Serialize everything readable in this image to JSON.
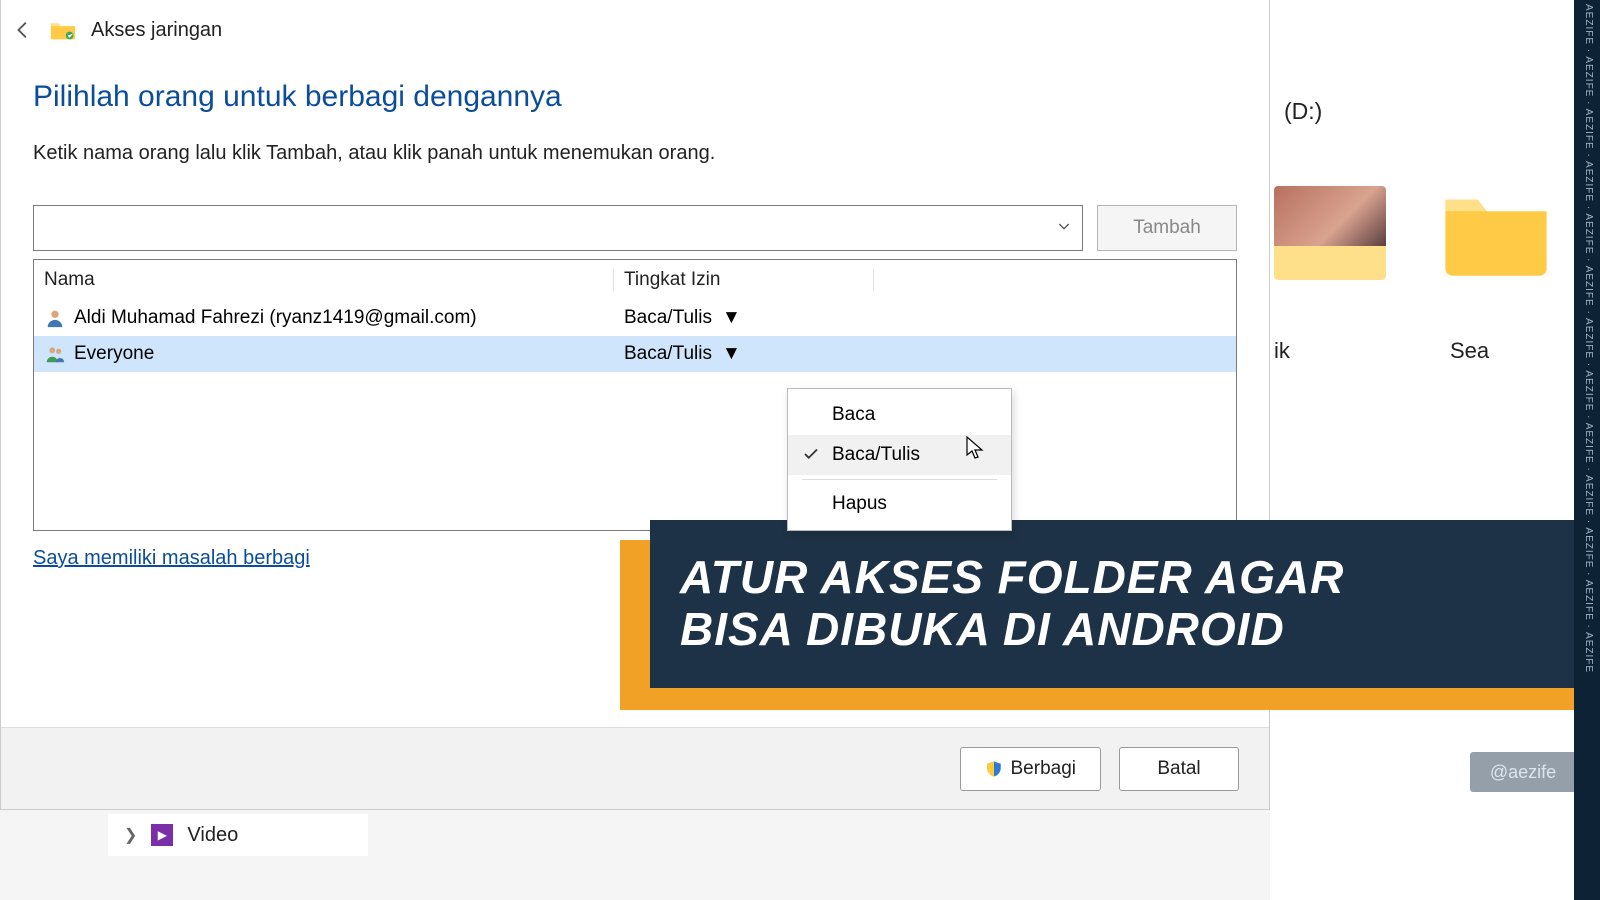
{
  "titlebar": {
    "title": "Akses jaringan"
  },
  "heading": "Pilihlah orang untuk berbagi dengannya",
  "instruction": "Ketik nama orang lalu klik Tambah, atau klik panah untuk menemukan orang.",
  "add_button": "Tambah",
  "table": {
    "col_name": "Nama",
    "col_perm": "Tingkat Izin",
    "rows": [
      {
        "name": "Aldi Muhamad Fahrezi (ryanz1419@gmail.com)",
        "perm": "Baca/Tulis",
        "icon": "user",
        "selected": false
      },
      {
        "name": "Everyone",
        "perm": "Baca/Tulis",
        "icon": "group",
        "selected": true
      }
    ]
  },
  "menu": {
    "item_read": "Baca",
    "item_readwrite": "Baca/Tulis",
    "item_remove": "Hapus"
  },
  "help_link": "Saya memiliki masalah berbagi",
  "footer": {
    "share": "Berbagi",
    "cancel": "Batal"
  },
  "background": {
    "drive_label": "(D:)",
    "folder_label_1": "ik",
    "folder_label_2": "Sea",
    "tree_item": "Video"
  },
  "watermark": "AEZIFE · AEZIFE · AEZIFE · AEZIFE · AEZIFE · AEZIFE · AEZIFE · AEZIFE · AEZIFE · AEZIFE · AEZIFE · AEZIFE · AEZIFE",
  "banner": {
    "line1": "ATUR AKSES FOLDER AGAR",
    "line2": "BISA DIBUKA DI ANDROID"
  },
  "handle": "@aezife"
}
